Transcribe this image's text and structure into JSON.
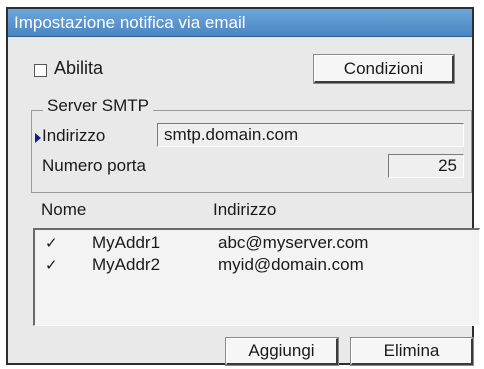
{
  "dialog": {
    "title": "Impostazione notifica via email",
    "enable_label": "Abilita",
    "enable_checked": false,
    "conditions_button": "Condizioni",
    "smtp": {
      "legend": "Server SMTP",
      "address_label": "Indirizzo",
      "address_value": "smtp.domain.com",
      "port_label": "Numero porta",
      "port_value": "25"
    },
    "list": {
      "col_name": "Nome",
      "col_address": "Indirizzo",
      "rows": [
        {
          "check": "✓",
          "name": "MyAddr1",
          "address": "abc@myserver.com"
        },
        {
          "check": "✓",
          "name": "MyAddr2",
          "address": "myid@domain.com"
        }
      ]
    },
    "add_button": "Aggiungi",
    "delete_button": "Elimina"
  }
}
